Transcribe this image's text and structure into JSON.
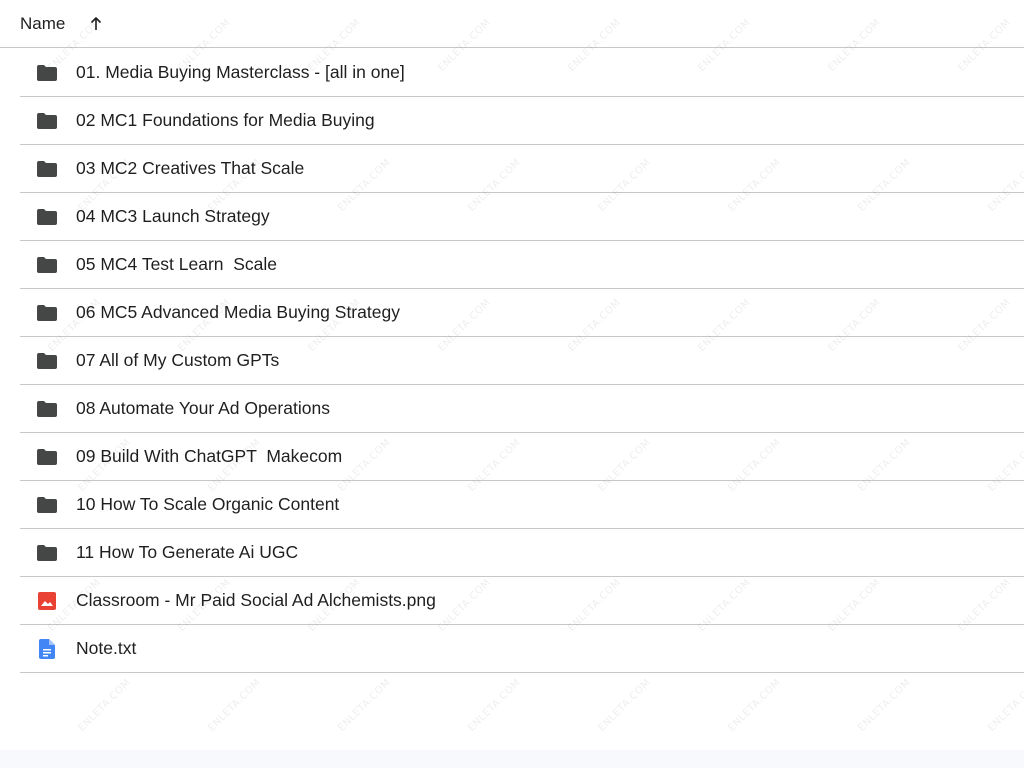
{
  "header": {
    "name_label": "Name"
  },
  "items": [
    {
      "name": "01. Media Buying Masterclass - [all in one]",
      "type": "folder-icon"
    },
    {
      "name": "02 MC1 Foundations for Media Buying",
      "type": "folder-icon"
    },
    {
      "name": "03 MC2 Creatives That Scale",
      "type": "folder-icon"
    },
    {
      "name": "04 MC3 Launch Strategy",
      "type": "folder-icon"
    },
    {
      "name": "05 MC4 Test Learn  Scale",
      "type": "folder-icon"
    },
    {
      "name": "06 MC5 Advanced Media Buying Strategy",
      "type": "folder-icon"
    },
    {
      "name": "07 All of My Custom GPTs",
      "type": "folder-icon"
    },
    {
      "name": "08 Automate Your Ad Operations",
      "type": "folder-icon"
    },
    {
      "name": "09 Build With ChatGPT  Makecom",
      "type": "folder-icon"
    },
    {
      "name": "10 How To Scale Organic Content",
      "type": "folder-icon"
    },
    {
      "name": "11 How To Generate Ai UGC",
      "type": "folder-icon"
    },
    {
      "name": "Classroom - Mr Paid Social Ad Alchemists.png",
      "type": "image-file-icon"
    },
    {
      "name": "Note.txt",
      "type": "doc-file-icon"
    }
  ],
  "watermark_text": "ENLETA.COM",
  "colors": {
    "folder": "#444746",
    "image_file": "#e94235",
    "doc_file": "#4285f4",
    "divider": "#c7c7c7",
    "text": "#1f1f1f"
  }
}
